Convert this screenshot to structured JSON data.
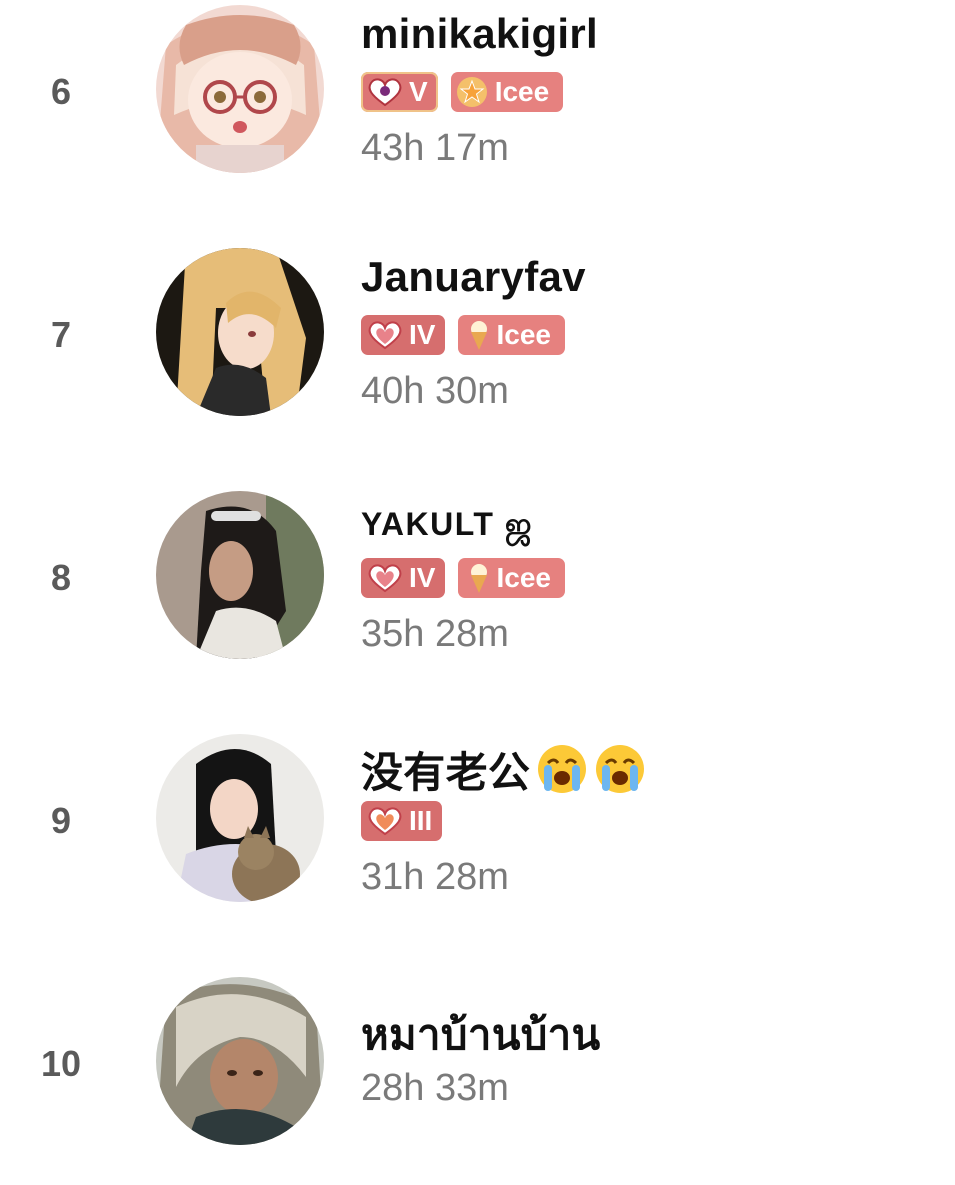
{
  "rows": [
    {
      "rank": "6",
      "name": "minikakigirl",
      "level": "V",
      "icee": "Icee",
      "time": "43h 17m"
    },
    {
      "rank": "7",
      "name": "Januaryfav",
      "level": "IV",
      "icee": "Icee",
      "time": "40h 30m"
    },
    {
      "rank": "8",
      "name": "YAKULT ஜ",
      "level": "IV",
      "icee": "Icee",
      "time": "35h 28m"
    },
    {
      "rank": "9",
      "name": "没有老公",
      "name_emojis": [
        "loudly-crying-face",
        "loudly-crying-face"
      ],
      "level": "III",
      "time": "31h 28m"
    },
    {
      "rank": "10",
      "name": "หมาบ้านบ้าน",
      "time": "28h 33m"
    }
  ],
  "colors": {
    "badge_bg": "#d66e6e",
    "icee_bg": "#e6817f",
    "rank_text": "#5a5a5a",
    "time_text": "#7a7a7a"
  }
}
